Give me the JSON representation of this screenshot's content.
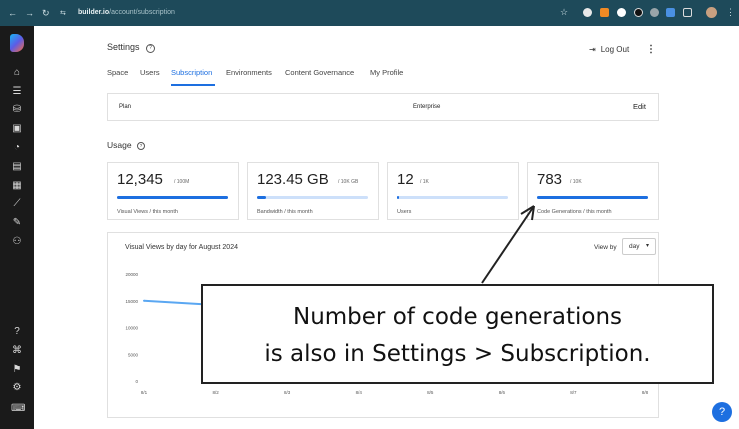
{
  "browser": {
    "url_host": "builder.io",
    "url_path": "/account/subscription",
    "back_glyph": "←",
    "forward_glyph": "→",
    "reload_glyph": "↻",
    "star_glyph": "☆",
    "icons": [
      "back-icon",
      "forward-icon",
      "reload-icon",
      "site-settings-icon",
      "star-icon"
    ]
  },
  "sidebar": {
    "glyphs": [
      "⌂",
      "☰",
      "⛁",
      "▣",
      "◔",
      "▤",
      "▦",
      "⟋",
      "✎",
      "⚇",
      "?",
      "⌘",
      "⚑",
      "⚙",
      "⌨"
    ],
    "icons": [
      "home-icon",
      "content-icon",
      "data-icon",
      "models-icon",
      "insights-icon",
      "docs-icon",
      "calendar-icon",
      "analytics-icon",
      "rocket-icon",
      "team-icon",
      "help-icon",
      "shortcut-icon",
      "announcements-icon",
      "settings-icon",
      "chat-icon"
    ]
  },
  "header": {
    "title": "Settings",
    "help_glyph": "?",
    "logout_label": "Log Out",
    "logout_glyph": "⇥",
    "more_glyph": "⋮"
  },
  "tabs": [
    {
      "label": "Space"
    },
    {
      "label": "Users"
    },
    {
      "label": "Subscription",
      "active": true
    },
    {
      "label": "Environments"
    },
    {
      "label": "Content Governance"
    },
    {
      "label": "My Profile"
    }
  ],
  "plan": {
    "label": "Plan",
    "value": "Enterprise",
    "edit_label": "Edit"
  },
  "usage": {
    "title": "Usage",
    "help_glyph": "?",
    "cards": [
      {
        "value": "12,345",
        "limit": "/ 100M",
        "caption": "Visual Views / this month",
        "fill_fraction": 0.999
      },
      {
        "value": "123.45 GB",
        "limit": "/ 10K GB",
        "caption": "Bandwidth / this month",
        "fill_fraction": 0.08
      },
      {
        "value": "12",
        "limit": "/ 1K",
        "caption": "Users",
        "fill_fraction": 0.02
      },
      {
        "value": "783",
        "limit": "/ 10K",
        "caption": "Code Generations / this month",
        "fill_fraction": 0.999
      }
    ]
  },
  "chart": {
    "title": "Visual Views by day for August 2024",
    "view_by_label": "View by",
    "view_by_value": "day",
    "caret_glyph": "▾"
  },
  "chart_data": {
    "type": "line",
    "categories": [
      "8/1",
      "8/2",
      "8/3",
      "8/4",
      "8/5",
      "8/6",
      "8/7",
      "8/8"
    ],
    "y_ticks": [
      "20000",
      "15000",
      "10000",
      "5000",
      "0"
    ],
    "ylim": [
      0,
      20000
    ],
    "series": [
      {
        "values": [
          15000,
          14200
        ]
      }
    ],
    "color": "#5aa7f2"
  },
  "callout": {
    "line1": "Number of code generations",
    "line2": "is also in Settings > Subscription."
  },
  "help_button": {
    "glyph": "?"
  },
  "colors": {
    "accent": "#1d6fe0",
    "browser_bar": "#1e4a5a",
    "sidebar": "#1a1a1a"
  }
}
